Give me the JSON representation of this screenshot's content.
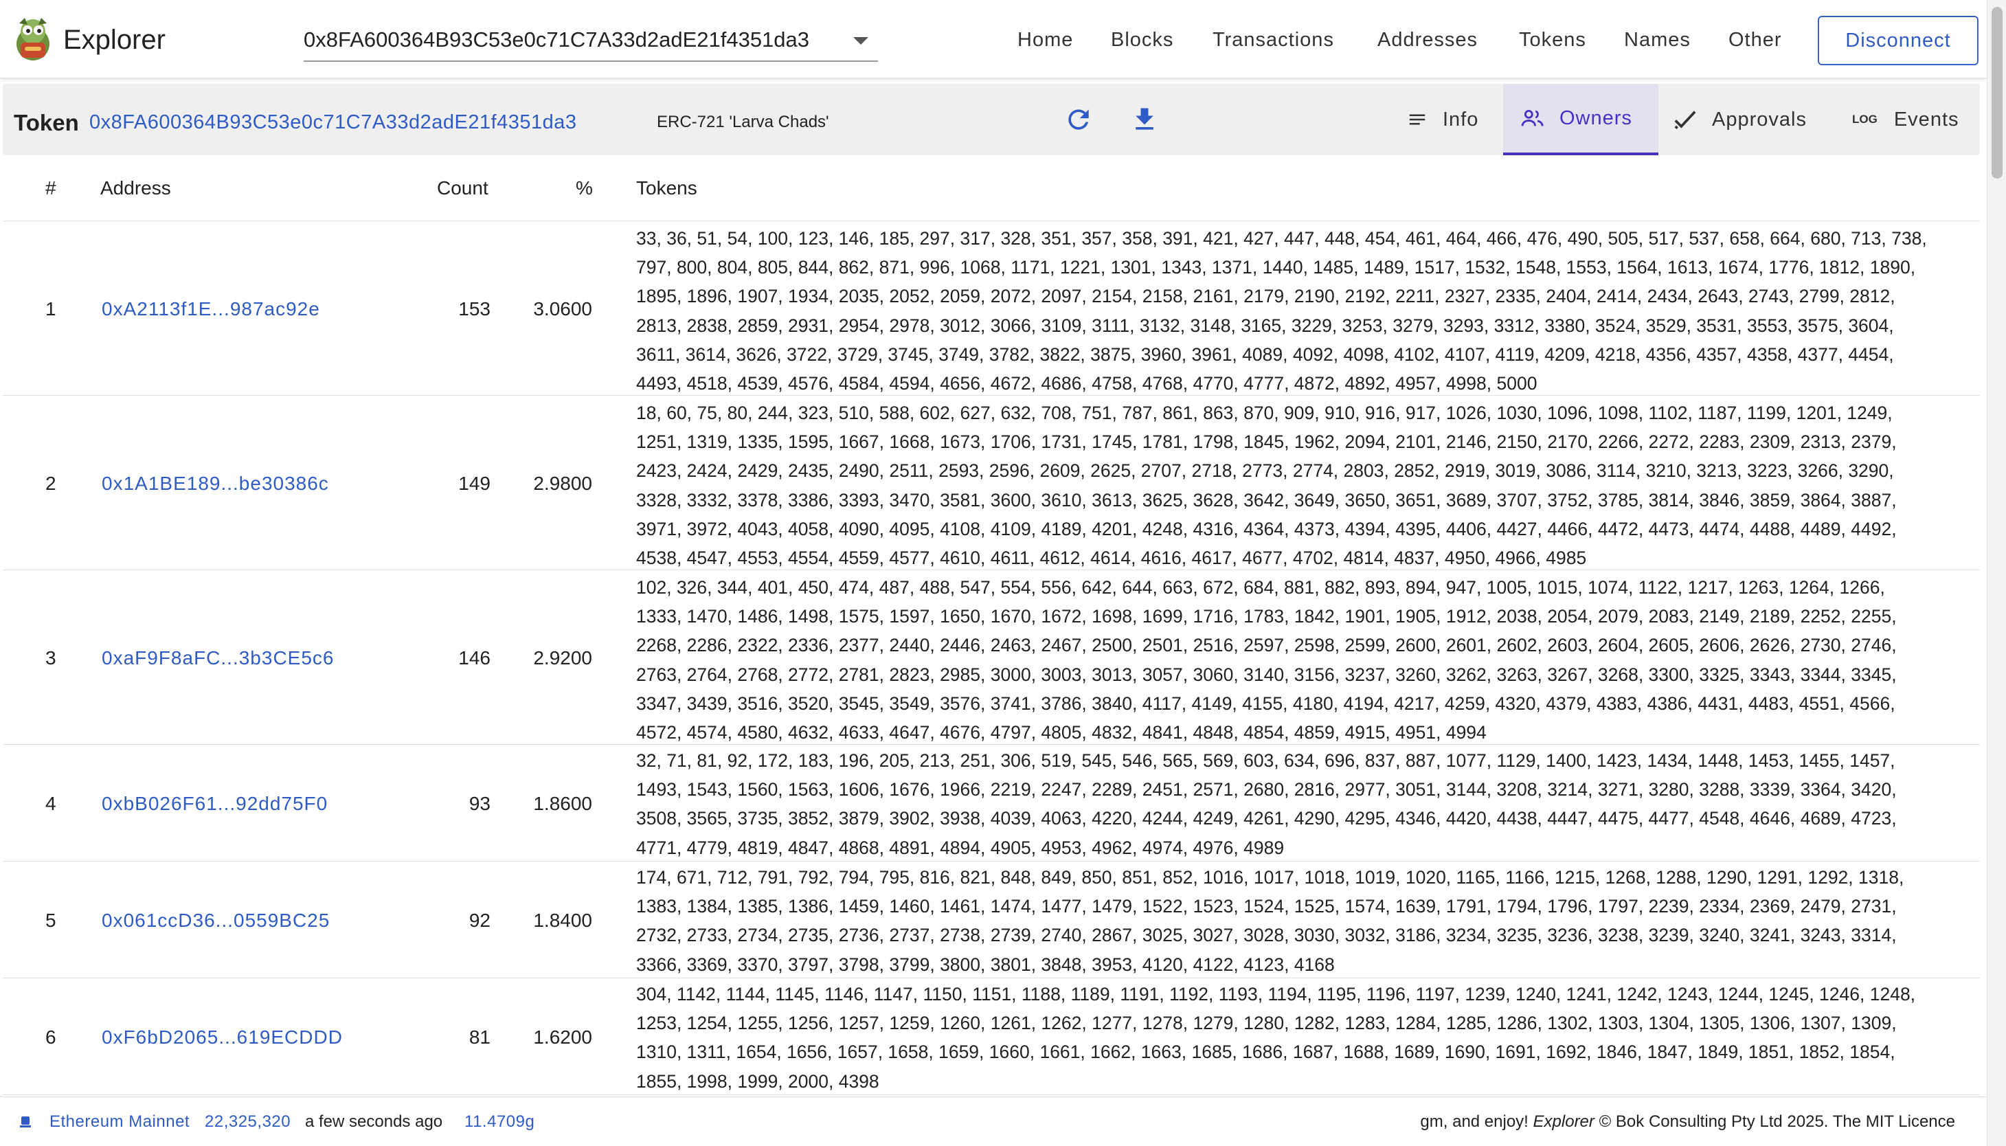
{
  "app": {
    "title": "Explorer",
    "selected_address": "0x8FA600364B93C53e0c71C7A33d2adE21f4351da3"
  },
  "nav": {
    "items": [
      "Home",
      "Blocks",
      "Transactions",
      "Addresses",
      "Tokens",
      "Names",
      "Other"
    ],
    "disconnect": "Disconnect"
  },
  "token": {
    "label": "Token",
    "address": "0x8FA600364B93C53e0c71C7A33d2adE21f4351da3",
    "type": "ERC-721 'Larva Chads'",
    "tabs": [
      {
        "label": "Info",
        "icon": "list-icon",
        "active": false
      },
      {
        "label": "Owners",
        "icon": "people-icon",
        "active": true
      },
      {
        "label": "Approvals",
        "icon": "check-icon",
        "active": false
      },
      {
        "label": "Events",
        "icon": "log-icon",
        "active": false
      }
    ],
    "log_icon_text": "LOG"
  },
  "table": {
    "headers": {
      "index": "#",
      "address": "Address",
      "count": "Count",
      "percent": "%",
      "tokens": "Tokens"
    },
    "rows": [
      {
        "index": "1",
        "address": "0xA2113f1E...987ac92e",
        "count": "153",
        "percent": "3.0600",
        "tokens": "33, 36, 51, 54, 100, 123, 146, 185, 297, 317, 328, 351, 357, 358, 391, 421, 427, 447, 448, 454, 461, 464, 466, 476, 490, 505, 517, 537, 658, 664, 680, 713, 738, 797, 800, 804, 805, 844, 862, 871, 996, 1068, 1171, 1221, 1301, 1343, 1371, 1440, 1485, 1489, 1517, 1532, 1548, 1553, 1564, 1613, 1674, 1776, 1812, 1890, 1895, 1896, 1907, 1934, 2035, 2052, 2059, 2072, 2097, 2154, 2158, 2161, 2179, 2190, 2192, 2211, 2327, 2335, 2404, 2414, 2434, 2643, 2743, 2799, 2812, 2813, 2838, 2859, 2931, 2954, 2978, 3012, 3066, 3109, 3111, 3132, 3148, 3165, 3229, 3253, 3279, 3293, 3312, 3380, 3524, 3529, 3531, 3553, 3575, 3604, 3611, 3614, 3626, 3722, 3729, 3745, 3749, 3782, 3822, 3875, 3960, 3961, 4089, 4092, 4098, 4102, 4107, 4119, 4209, 4218, 4356, 4357, 4358, 4377, 4454, 4493, 4518, 4539, 4576, 4584, 4594, 4656, 4672, 4686, 4758, 4768, 4770, 4777, 4872, 4892, 4957, 4998, 5000"
      },
      {
        "index": "2",
        "address": "0x1A1BE189...be30386c",
        "count": "149",
        "percent": "2.9800",
        "tokens": "18, 60, 75, 80, 244, 323, 510, 588, 602, 627, 632, 708, 751, 787, 861, 863, 870, 909, 910, 916, 917, 1026, 1030, 1096, 1098, 1102, 1187, 1199, 1201, 1249, 1251, 1319, 1335, 1595, 1667, 1668, 1673, 1706, 1731, 1745, 1781, 1798, 1845, 1962, 2094, 2101, 2146, 2150, 2170, 2266, 2272, 2283, 2309, 2313, 2379, 2423, 2424, 2429, 2435, 2490, 2511, 2593, 2596, 2609, 2625, 2707, 2718, 2773, 2774, 2803, 2852, 2919, 3019, 3086, 3114, 3210, 3213, 3223, 3266, 3290, 3328, 3332, 3378, 3386, 3393, 3470, 3581, 3600, 3610, 3613, 3625, 3628, 3642, 3649, 3650, 3651, 3689, 3707, 3752, 3785, 3814, 3846, 3859, 3864, 3887, 3971, 3972, 4043, 4058, 4090, 4095, 4108, 4109, 4189, 4201, 4248, 4316, 4364, 4373, 4394, 4395, 4406, 4427, 4466, 4472, 4473, 4474, 4488, 4489, 4492, 4538, 4547, 4553, 4554, 4559, 4577, 4610, 4611, 4612, 4614, 4616, 4617, 4677, 4702, 4814, 4837, 4950, 4966, 4985"
      },
      {
        "index": "3",
        "address": "0xaF9F8aFC...3b3CE5c6",
        "count": "146",
        "percent": "2.9200",
        "tokens": "102, 326, 344, 401, 450, 474, 487, 488, 547, 554, 556, 642, 644, 663, 672, 684, 881, 882, 893, 894, 947, 1005, 1015, 1074, 1122, 1217, 1263, 1264, 1266, 1333, 1470, 1486, 1498, 1575, 1597, 1650, 1670, 1672, 1698, 1699, 1716, 1783, 1842, 1901, 1905, 1912, 2038, 2054, 2079, 2083, 2149, 2189, 2252, 2255, 2268, 2286, 2322, 2336, 2377, 2440, 2446, 2463, 2467, 2500, 2501, 2516, 2597, 2598, 2599, 2600, 2601, 2602, 2603, 2604, 2605, 2606, 2626, 2730, 2746, 2763, 2764, 2768, 2772, 2781, 2823, 2985, 3000, 3003, 3013, 3057, 3060, 3140, 3156, 3237, 3260, 3262, 3263, 3267, 3268, 3300, 3325, 3343, 3344, 3345, 3347, 3439, 3516, 3520, 3545, 3549, 3576, 3741, 3786, 3840, 4117, 4149, 4155, 4180, 4194, 4217, 4259, 4320, 4379, 4383, 4386, 4431, 4483, 4551, 4566, 4572, 4574, 4580, 4632, 4633, 4647, 4676, 4797, 4805, 4832, 4841, 4848, 4854, 4859, 4915, 4951, 4994"
      },
      {
        "index": "4",
        "address": "0xbB026F61...92dd75F0",
        "count": "93",
        "percent": "1.8600",
        "tokens": "32, 71, 81, 92, 172, 183, 196, 205, 213, 251, 306, 519, 545, 546, 565, 569, 603, 634, 696, 837, 887, 1077, 1129, 1400, 1423, 1434, 1448, 1453, 1455, 1457, 1493, 1543, 1560, 1563, 1606, 1676, 1966, 2219, 2247, 2289, 2451, 2571, 2680, 2816, 2977, 3051, 3144, 3208, 3214, 3271, 3280, 3288, 3339, 3364, 3420, 3508, 3565, 3735, 3852, 3879, 3902, 3938, 4039, 4063, 4220, 4244, 4249, 4261, 4290, 4295, 4346, 4420, 4438, 4447, 4475, 4477, 4548, 4646, 4689, 4723, 4771, 4779, 4819, 4847, 4868, 4891, 4894, 4905, 4953, 4962, 4974, 4976, 4989"
      },
      {
        "index": "5",
        "address": "0x061ccD36...0559BC25",
        "count": "92",
        "percent": "1.8400",
        "tokens": "174, 671, 712, 791, 792, 794, 795, 816, 821, 848, 849, 850, 851, 852, 1016, 1017, 1018, 1019, 1020, 1165, 1166, 1215, 1268, 1288, 1290, 1291, 1292, 1318, 1383, 1384, 1385, 1386, 1459, 1460, 1461, 1474, 1477, 1479, 1522, 1523, 1524, 1525, 1574, 1639, 1791, 1794, 1796, 1797, 2239, 2334, 2369, 2479, 2731, 2732, 2733, 2734, 2735, 2736, 2737, 2738, 2739, 2740, 2867, 3025, 3027, 3028, 3030, 3032, 3186, 3234, 3235, 3236, 3238, 3239, 3240, 3241, 3243, 3314, 3366, 3369, 3370, 3797, 3798, 3799, 3800, 3801, 3848, 3953, 4120, 4122, 4123, 4168"
      },
      {
        "index": "6",
        "address": "0xF6bD2065...619ECDDD",
        "count": "81",
        "percent": "1.6200",
        "tokens": "304, 1142, 1144, 1145, 1146, 1147, 1150, 1151, 1188, 1189, 1191, 1192, 1193, 1194, 1195, 1196, 1197, 1239, 1240, 1241, 1242, 1243, 1244, 1245, 1246, 1248, 1253, 1254, 1255, 1256, 1257, 1259, 1260, 1261, 1262, 1277, 1278, 1279, 1280, 1282, 1283, 1284, 1285, 1286, 1302, 1303, 1304, 1305, 1306, 1307, 1309, 1310, 1311, 1654, 1656, 1657, 1658, 1659, 1660, 1661, 1662, 1663, 1685, 1686, 1687, 1688, 1689, 1690, 1691, 1692, 1846, 1847, 1849, 1851, 1852, 1854, 1855, 1998, 1999, 2000, 4398"
      }
    ]
  },
  "footer": {
    "network": "Ethereum Mainnet",
    "block": "22,325,320",
    "time": "a few seconds ago",
    "gas": "11.4709g",
    "credit_prefix": "gm, and enjoy! ",
    "credit_app": "Explorer",
    "credit_suffix": " © Bok Consulting Pty Ltd 2025. The MIT Licence"
  },
  "colors": {
    "link": "#2f5bc6",
    "active_tab": "#4b2fc2",
    "toolbar_bg": "#efefef"
  }
}
